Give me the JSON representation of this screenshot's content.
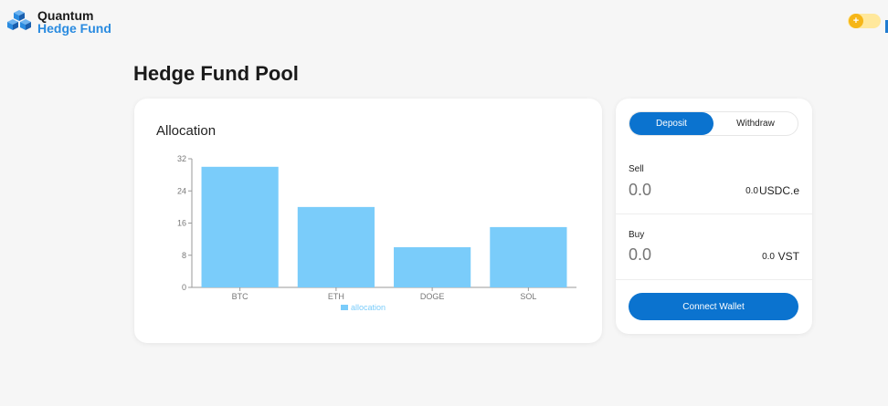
{
  "header": {
    "logo_line1": "Quantum",
    "logo_line2": "Hedge Fund",
    "logo_icon": "cubes-icon",
    "theme_toggle_icon": "plus-sun-icon"
  },
  "page": {
    "title": "Hedge Fund Pool"
  },
  "allocation_card": {
    "title": "Allocation"
  },
  "chart_data": {
    "type": "bar",
    "categories": [
      "BTC",
      "ETH",
      "DOGE",
      "SOL"
    ],
    "series": [
      {
        "name": "allocation",
        "values": [
          30,
          20,
          10,
          15
        ]
      }
    ],
    "yticks": [
      0,
      8,
      16,
      24,
      32
    ],
    "ylim": [
      0,
      32
    ],
    "grid": false,
    "legend": "bottom",
    "bar_color": "#7accfa"
  },
  "trade": {
    "tabs": [
      "Deposit",
      "Withdraw"
    ],
    "active_tab": "Deposit",
    "sell": {
      "label": "Sell",
      "placeholder": "0.0",
      "balance": "0.0",
      "token": "USDC.e"
    },
    "buy": {
      "label": "Buy",
      "placeholder": "0.0",
      "balance": "0.0",
      "token": "VST"
    },
    "connect_label": "Connect Wallet"
  },
  "colors": {
    "accent": "#0b73cf",
    "brand_text": "#2a8be0",
    "bar": "#7accfa"
  }
}
